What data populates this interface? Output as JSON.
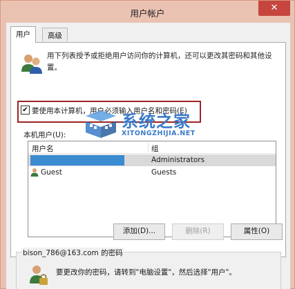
{
  "window": {
    "title": "用户帐户",
    "close_glyph": "✕"
  },
  "tabs": [
    {
      "label": "用户",
      "active": true
    },
    {
      "label": "高级",
      "active": false
    }
  ],
  "description": "用下列表授予或拒绝用户访问你的计算机，还可以更改其密码和其他设置。",
  "require_login": {
    "checked": true,
    "check_glyph": "✔",
    "label": "要使用本计算机，用户必须输入用户名和密码(E)"
  },
  "local_users_label": "本机用户(U):",
  "table": {
    "columns": [
      "用户名",
      "组"
    ],
    "rows": [
      {
        "name": "",
        "group": "Administrators",
        "selected": true
      },
      {
        "name": "Guest",
        "group": "Guests",
        "selected": false
      }
    ]
  },
  "buttons": {
    "add": "添加(D)...",
    "remove": "删除(R)",
    "properties": "属性(O)"
  },
  "password_section": {
    "title": "bison_786@163.com 的密码",
    "text": "要更改你的密码，请转到\"电脑设置\"，然后选择\"用户\"。"
  },
  "watermark": {
    "title": "系统之家",
    "subtitle": "XITONGZHIJIA.NET"
  },
  "colors": {
    "title_bar": "#eac2b2",
    "close_button": "#c7453f",
    "selection": "#3b8bd0",
    "highlight_border": "#9c2424",
    "watermark": "#3a7bc8"
  }
}
